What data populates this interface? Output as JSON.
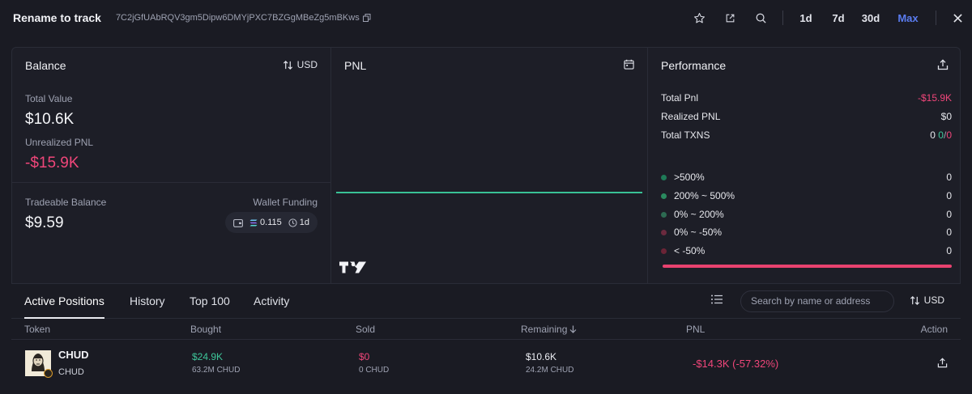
{
  "header": {
    "wallet_name": "Rename to track",
    "wallet_address": "7C2jGfUAbRQV3gm5Dipw6DMYjPXC7BZGgMBeZg5mBKws",
    "ranges": [
      "1d",
      "7d",
      "30d",
      "Max"
    ],
    "active_range": "Max"
  },
  "balance": {
    "title": "Balance",
    "currency": "USD",
    "total_value_label": "Total Value",
    "total_value": "$10.6K",
    "unrealized_label": "Unrealized PNL",
    "unrealized_value": "-$15.9K",
    "tradeable_label": "Tradeable Balance",
    "tradeable_value": "$9.59",
    "funding_label": "Wallet Funding",
    "funding_amount": "0.115",
    "funding_age": "1d"
  },
  "pnl": {
    "title": "PNL"
  },
  "performance": {
    "title": "Performance",
    "total_pnl_label": "Total Pnl",
    "total_pnl": "-$15.9K",
    "realized_label": "Realized PNL",
    "realized": "$0",
    "txns_label": "Total TXNS",
    "txns_total": "0",
    "txns_buys": "0",
    "txns_sells": "0",
    "distribution": [
      {
        "label": ">500%",
        "count": "0",
        "color": "#1f7a57"
      },
      {
        "label": "200% ~ 500%",
        "count": "0",
        "color": "#2a8a5f"
      },
      {
        "label": "0% ~ 200%",
        "count": "0",
        "color": "#2d6b52"
      },
      {
        "label": "0% ~ -50%",
        "count": "0",
        "color": "#6b2a3e"
      },
      {
        "label": "< -50%",
        "count": "0",
        "color": "#6b2436"
      }
    ]
  },
  "tabs": [
    "Active Positions",
    "History",
    "Top 100",
    "Activity"
  ],
  "search": {
    "placeholder": "Search by name or address"
  },
  "currency_toggle": "USD",
  "table": {
    "columns": [
      "Token",
      "Bought",
      "Sold",
      "Remaining",
      "PNL",
      "Action"
    ],
    "rows": [
      {
        "symbol": "CHUD",
        "name": "CHUD",
        "bought_usd": "$24.9K",
        "bought_qty": "63.2M CHUD",
        "sold_usd": "$0",
        "sold_qty": "0 CHUD",
        "remaining_usd": "$10.6K",
        "remaining_qty": "24.2M CHUD",
        "pnl": "-$14.3K (-57.32%)"
      }
    ]
  },
  "colors": {
    "accent": "#5a7cf0",
    "positive": "#3ec79a",
    "negative": "#f0467a",
    "background": "#1a1b23"
  }
}
